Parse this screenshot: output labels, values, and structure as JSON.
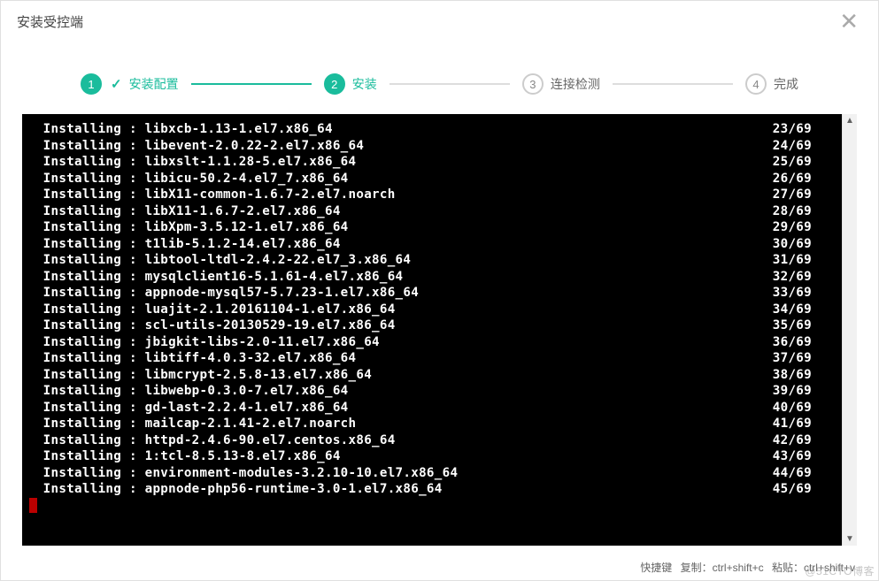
{
  "dialog": {
    "title": "安装受控端"
  },
  "steps": [
    {
      "num": "1",
      "label": "安装配置",
      "state": "done",
      "check": true
    },
    {
      "num": "2",
      "label": "安装",
      "state": "active",
      "check": false
    },
    {
      "num": "3",
      "label": "连接检测",
      "state": "pending",
      "check": false
    },
    {
      "num": "4",
      "label": "完成",
      "state": "pending",
      "check": false
    }
  ],
  "terminal": {
    "lines": [
      {
        "pkg": "libxcb-1.13-1.el7.x86_64",
        "n": "23/69"
      },
      {
        "pkg": "libevent-2.0.22-2.el7.x86_64",
        "n": "24/69"
      },
      {
        "pkg": "libxslt-1.1.28-5.el7.x86_64",
        "n": "25/69"
      },
      {
        "pkg": "libicu-50.2-4.el7_7.x86_64",
        "n": "26/69"
      },
      {
        "pkg": "libX11-common-1.6.7-2.el7.noarch",
        "n": "27/69"
      },
      {
        "pkg": "libX11-1.6.7-2.el7.x86_64",
        "n": "28/69"
      },
      {
        "pkg": "libXpm-3.5.12-1.el7.x86_64",
        "n": "29/69"
      },
      {
        "pkg": "t1lib-5.1.2-14.el7.x86_64",
        "n": "30/69"
      },
      {
        "pkg": "libtool-ltdl-2.4.2-22.el7_3.x86_64",
        "n": "31/69"
      },
      {
        "pkg": "mysqlclient16-5.1.61-4.el7.x86_64",
        "n": "32/69"
      },
      {
        "pkg": "appnode-mysql57-5.7.23-1.el7.x86_64",
        "n": "33/69"
      },
      {
        "pkg": "luajit-2.1.20161104-1.el7.x86_64",
        "n": "34/69"
      },
      {
        "pkg": "scl-utils-20130529-19.el7.x86_64",
        "n": "35/69"
      },
      {
        "pkg": "jbigkit-libs-2.0-11.el7.x86_64",
        "n": "36/69"
      },
      {
        "pkg": "libtiff-4.0.3-32.el7.x86_64",
        "n": "37/69"
      },
      {
        "pkg": "libmcrypt-2.5.8-13.el7.x86_64",
        "n": "38/69"
      },
      {
        "pkg": "libwebp-0.3.0-7.el7.x86_64",
        "n": "39/69"
      },
      {
        "pkg": "gd-last-2.2.4-1.el7.x86_64",
        "n": "40/69"
      },
      {
        "pkg": "mailcap-2.1.41-2.el7.noarch",
        "n": "41/69"
      },
      {
        "pkg": "httpd-2.4.6-90.el7.centos.x86_64",
        "n": "42/69"
      },
      {
        "pkg": "1:tcl-8.5.13-8.el7.x86_64",
        "n": "43/69"
      },
      {
        "pkg": "environment-modules-3.2.10-10.el7.x86_64",
        "n": "44/69"
      },
      {
        "pkg": "appnode-php56-runtime-3.0-1.el7.x86_64",
        "n": "45/69"
      }
    ],
    "prefix": "  Installing : "
  },
  "footer": {
    "shortcut_label": "快捷键",
    "copy": "复制：ctrl+shift+c",
    "paste": "粘贴：ctrl+shift+v"
  },
  "watermark": "@51CTO博客"
}
